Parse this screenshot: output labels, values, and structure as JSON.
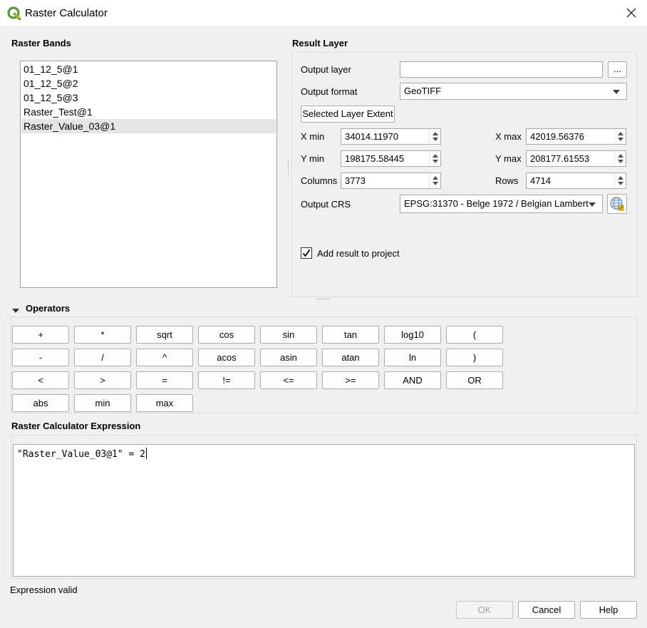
{
  "window": {
    "title": "Raster Calculator",
    "icon": "qgis-logo-icon",
    "close_icon": "close-icon"
  },
  "raster_bands": {
    "title": "Raster Bands",
    "items": [
      "01_12_5@1",
      "01_12_5@2",
      "01_12_5@3",
      "Raster_Test@1",
      "Raster_Value_03@1"
    ],
    "selected": "Raster_Value_03@1"
  },
  "result_layer": {
    "title": "Result Layer",
    "output_layer_label": "Output layer",
    "output_layer_value": "",
    "browse_label": "...",
    "output_format_label": "Output format",
    "output_format_value": "GeoTIFF",
    "selected_extent_label": "Selected Layer Extent",
    "xmin_label": "X min",
    "xmin_value": "34014.11970",
    "xmax_label": "X max",
    "xmax_value": "42019.56376",
    "ymin_label": "Y min",
    "ymin_value": "198175.58445",
    "ymax_label": "Y max",
    "ymax_value": "208177.61553",
    "columns_label": "Columns",
    "columns_value": "3773",
    "rows_label": "Rows",
    "rows_value": "4714",
    "crs_label": "Output CRS",
    "crs_value": "EPSG:31370 - Belge 1972 / Belgian Lambert",
    "crs_select_icon": "globe-crs-icon",
    "add_result_label": "Add result to project",
    "add_result_checked": true
  },
  "operators": {
    "title": "Operators",
    "collapse_icon": "triangle-down-icon",
    "rows": [
      [
        "+",
        "*",
        "sqrt",
        "cos",
        "sin",
        "tan",
        "log10",
        "("
      ],
      [
        "-",
        "/",
        "^",
        "acos",
        "asin",
        "atan",
        "ln",
        ")"
      ],
      [
        "<",
        ">",
        "=",
        "!=",
        "<=",
        ">=",
        "AND",
        "OR"
      ],
      [
        "abs",
        "min",
        "max"
      ]
    ]
  },
  "expression": {
    "title": "Raster Calculator Expression",
    "value": "\"Raster_Value_03@1\" = 2",
    "status": "Expression valid"
  },
  "footer": {
    "ok_label": "OK",
    "cancel_label": "Cancel",
    "help_label": "Help"
  },
  "colors": {
    "qgis_green": "#589632",
    "qgis_yellow": "#ee7913"
  }
}
